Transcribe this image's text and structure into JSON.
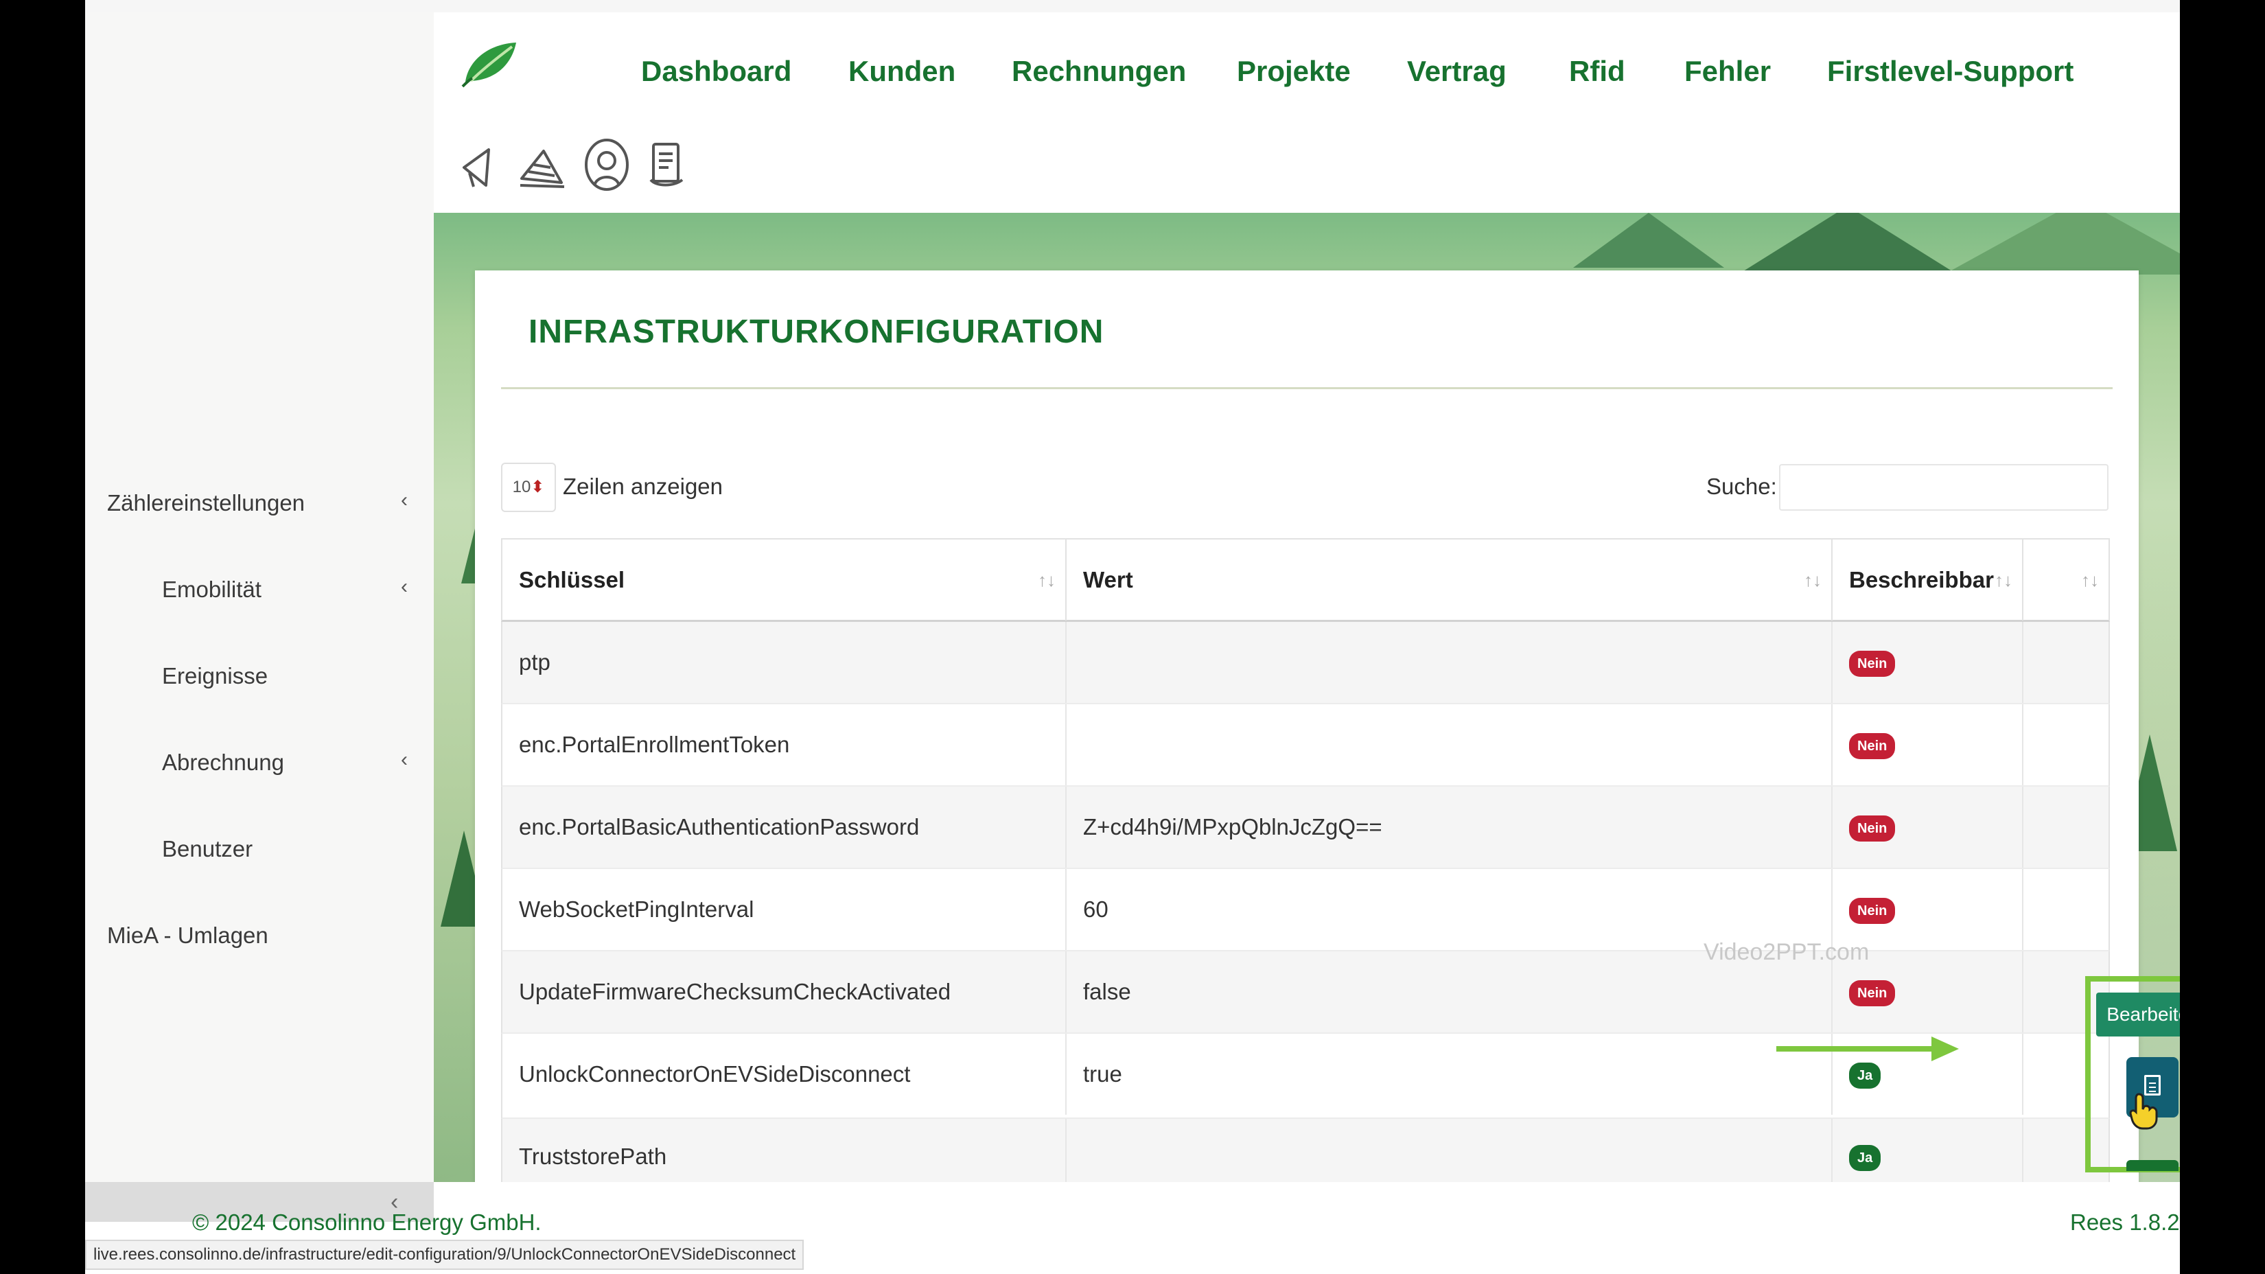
{
  "nav": {
    "items": [
      "Dashboard",
      "Kunden",
      "Rechnungen",
      "Projekte",
      "Vertrag",
      "Rfid",
      "Fehler",
      "Firstlevel-Support"
    ]
  },
  "toolbar_icons": [
    "megaphone-icon",
    "cone-icon",
    "support-agent-icon",
    "document-list-icon"
  ],
  "sidebar": {
    "items": [
      {
        "label": "Zählereinstellungen",
        "has_chevron": true
      },
      {
        "label": "Emobilität",
        "has_chevron": true
      },
      {
        "label": "Ereignisse",
        "has_chevron": false
      },
      {
        "label": "Abrechnung",
        "has_chevron": true
      },
      {
        "label": "Benutzer",
        "has_chevron": false
      },
      {
        "label": "MieA - Umlagen",
        "has_chevron": false
      }
    ],
    "collapse_glyph": "‹"
  },
  "page": {
    "title": "INFRASTRUKTURKONFIGURATION",
    "length_value": "10",
    "length_label": "Zeilen anzeigen",
    "search_label": "Suche:",
    "search_value": ""
  },
  "table": {
    "columns": [
      "Schlüssel",
      "Wert",
      "Beschreibbar",
      ""
    ],
    "rows": [
      {
        "key": "ptp",
        "value": "",
        "writable": "Nein"
      },
      {
        "key": "enc.PortalEnrollmentToken",
        "value": "",
        "writable": "Nein"
      },
      {
        "key": "enc.PortalBasicAuthenticationPassword",
        "value": "Z+cd4h9i/MPxpQblnJcZgQ==",
        "writable": "Nein"
      },
      {
        "key": "WebSocketPingInterval",
        "value": "60",
        "writable": "Nein"
      },
      {
        "key": "UpdateFirmwareChecksumCheckActivated",
        "value": "false",
        "writable": "Nein"
      },
      {
        "key": "UnlockConnectorOnEVSideDisconnect",
        "value": "true",
        "writable": "Ja"
      },
      {
        "key": "TruststorePath",
        "value": "",
        "writable": "Ja"
      }
    ]
  },
  "tooltip": {
    "edit": "Bearbeiten"
  },
  "watermark": "Video2PPT.com",
  "footer": {
    "copyright": "© 2024 Consolinno Energy GmbH.",
    "version": "Rees 1.8.2"
  },
  "statusbar_url": "live.rees.consolinno.de/infrastructure/edit-configuration/9/UnlockConnectorOnEVSideDisconnect",
  "colors": {
    "brand_green": "#17722f",
    "badge_no": "#c42035",
    "badge_yes": "#17722f",
    "highlight": "#7ec73e",
    "edit_button": "#125f73"
  }
}
